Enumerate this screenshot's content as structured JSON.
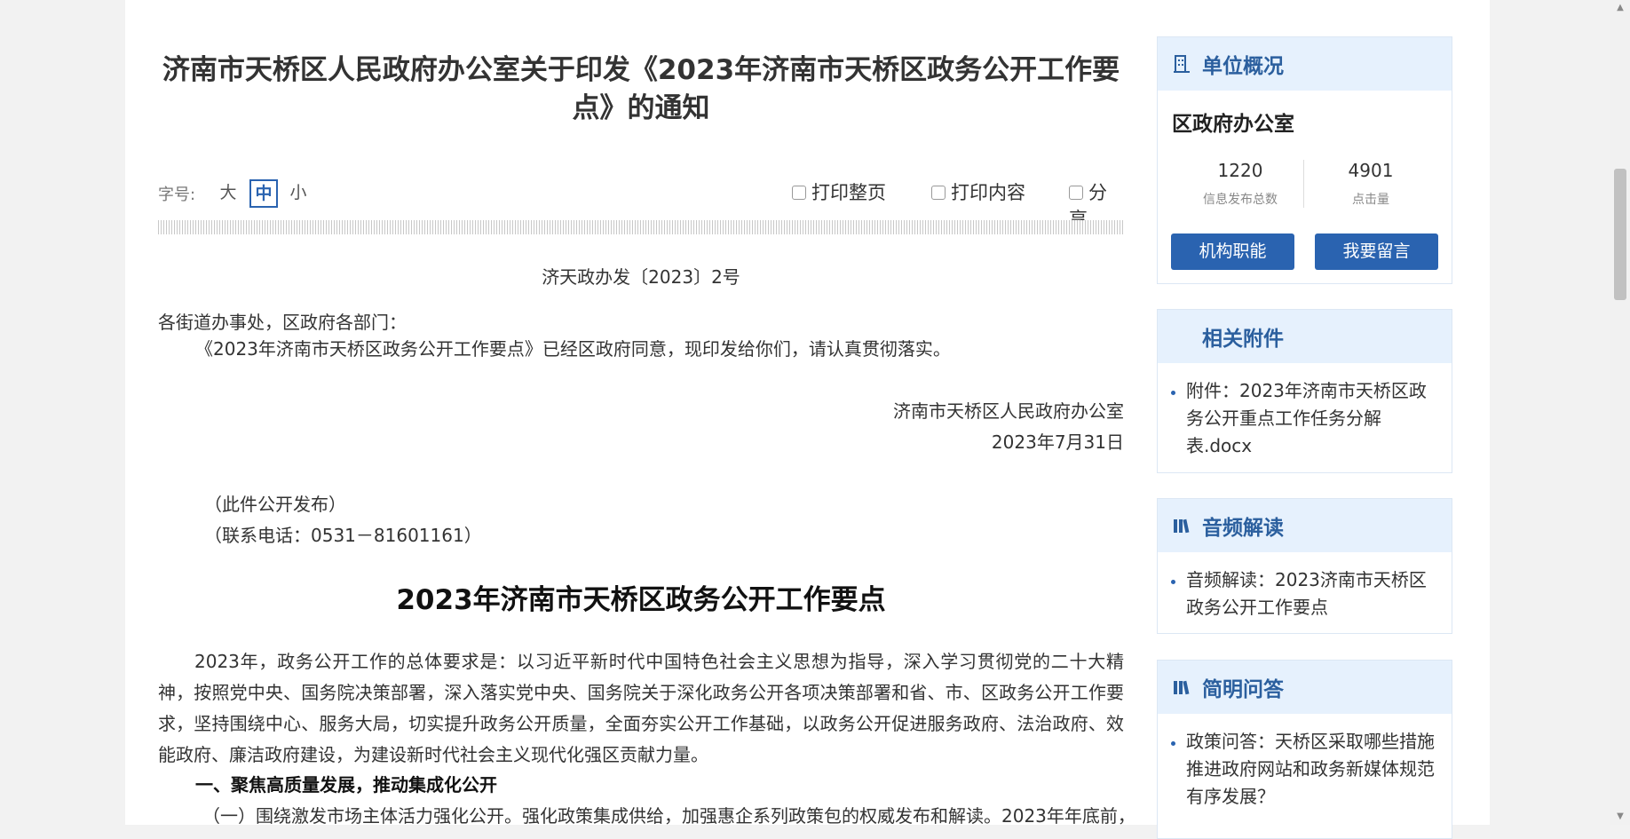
{
  "article": {
    "title": "济南市天桥区人民政府办公室关于印发《2023年济南市天桥区政务公开工作要点》的通知",
    "font_size": {
      "label": "字号:",
      "large": "大",
      "medium": "中",
      "small": "小"
    },
    "toolbar": {
      "print_page": "打印整页",
      "print_content": "打印内容",
      "share": "分享"
    },
    "doc_number": "济天政办发〔2023〕2号",
    "addressee": "各街道办事处，区政府各部门：",
    "intro": "《2023年济南市天桥区政务公开工作要点》已经区政府同意，现印发给你们，请认真贯彻落实。",
    "signature_org": "济南市天桥区人民政府办公室",
    "signature_date": "2023年7月31日",
    "note_public": "（此件公开发布）",
    "note_contact": "（联系电话：0531－81601161）",
    "section_title": "2023年济南市天桥区政务公开工作要点",
    "body_paragraph": "2023年，政务公开工作的总体要求是：以习近平新时代中国特色社会主义思想为指导，深入学习贯彻党的二十大精神，按照党中央、国务院决策部署，深入落实党中央、国务院关于深化政务公开各项决策部署和省、市、区政务公开工作要求，坚持围绕中心、服务大局，切实提升政务公开质量，全面夯实公开工作基础，以政务公开促进服务政府、法治政府、效能政府、廉洁政府建设，为建设新时代社会主义现代化强区贡献力量。",
    "heading_1": "一、聚焦高质量发展，推动集成化公开",
    "paragraph_2": "（一）围绕激发市场主体活力强化公开。强化政策集成供给，加强惠企系列政策包的权威发布和解读。2023年年底前，"
  },
  "sidebar": {
    "unit_overview": {
      "title": "单位概况",
      "unit_name": "区政府办公室",
      "stats": [
        {
          "value": "1220",
          "label": "信息发布总数"
        },
        {
          "value": "4901",
          "label": "点击量"
        }
      ],
      "buttons": [
        "机构职能",
        "我要留言"
      ]
    },
    "attachments": {
      "title": "相关附件",
      "items": [
        "附件：2023年济南市天桥区政务公开重点工作任务分解表.docx"
      ]
    },
    "audio": {
      "title": "音频解读",
      "items": [
        "音频解读：2023济南市天桥区政务公开工作要点"
      ]
    },
    "qa": {
      "title": "简明问答",
      "items": [
        "政策问答：天桥区采取哪些措施推进政府网站和政务新媒体规范有序发展？"
      ]
    }
  },
  "colors": {
    "accent": "#2a63b0",
    "panel_header_bg": "#e6f1fd",
    "panel_title": "#2b5f9e"
  }
}
